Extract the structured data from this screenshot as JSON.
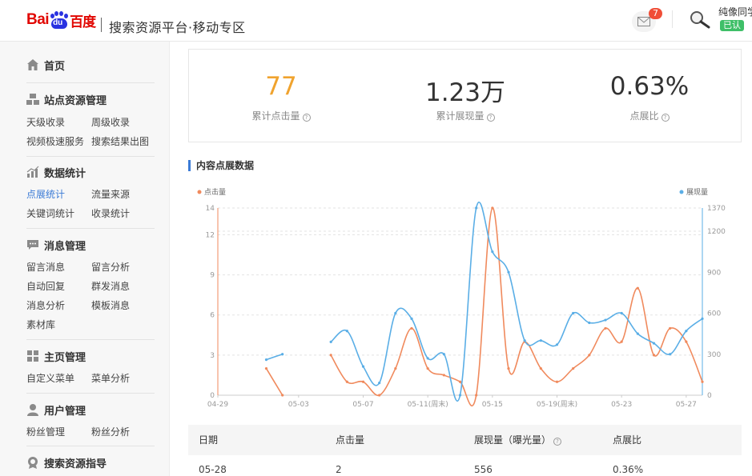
{
  "header": {
    "logo_bai": "Bai",
    "logo_du": "du",
    "logo_cn": "百度",
    "platform_title": "搜索资源平台·移动专区",
    "mail_badge": "7",
    "user_name": "纯像同学",
    "verified": "已认"
  },
  "sidebar": {
    "home": "首页",
    "sections": [
      {
        "title": "站点资源管理",
        "icon": "site-icon",
        "items": [
          "天级收录",
          "周级收录",
          "视频极速服务",
          "搜索结果出图"
        ]
      },
      {
        "title": "数据统计",
        "icon": "chart-icon",
        "items": [
          "点展统计",
          "流量来源",
          "关键词统计",
          "收录统计"
        ]
      },
      {
        "title": "消息管理",
        "icon": "message-icon",
        "items": [
          "留言消息",
          "留言分析",
          "自动回复",
          "群发消息",
          "消息分析",
          "模板消息",
          "素材库"
        ]
      },
      {
        "title": "主页管理",
        "icon": "homepage-icon",
        "items": [
          "自定义菜单",
          "菜单分析"
        ]
      },
      {
        "title": "用户管理",
        "icon": "user-icon",
        "items": [
          "粉丝管理",
          "粉丝分析"
        ]
      },
      {
        "title": "搜索资源指导",
        "icon": "guide-icon",
        "items": []
      }
    ],
    "active_item": "点展统计"
  },
  "stats": [
    {
      "value": "77",
      "label": "累计点击量",
      "color": "#f0a32e"
    },
    {
      "value": "1.23万",
      "label": "累计展现量",
      "color": "#333333"
    },
    {
      "value": "0.63%",
      "label": "点展比",
      "color": "#333333"
    }
  ],
  "section_title": "内容点展数据",
  "chart_data": {
    "type": "line",
    "x_tick_labels": [
      "04-29",
      "05-03",
      "05-07",
      "05-11(周末)",
      "05-15",
      "05-19(周末)",
      "05-23",
      "05-27"
    ],
    "x_range": [
      "04-29",
      "05-28"
    ],
    "left_axis": {
      "ticks": [
        0,
        3,
        6,
        9,
        12,
        14
      ],
      "ylim": [
        0,
        14
      ]
    },
    "right_axis": {
      "ticks": [
        0,
        300,
        600,
        900,
        1200,
        1370
      ],
      "ylim": [
        0,
        1370
      ]
    },
    "legend_left": "点击量",
    "legend_right": "展现量",
    "colors": {
      "clicks": "#f08a5d",
      "impressions": "#5aaee6"
    },
    "series": [
      {
        "name": "点击量",
        "axis": "left",
        "points": [
          [
            "05-01",
            2
          ],
          [
            "05-02",
            0
          ],
          null,
          [
            "05-05",
            3
          ],
          [
            "05-06",
            1
          ],
          [
            "05-07",
            1
          ],
          [
            "05-08",
            0
          ],
          [
            "05-09",
            2
          ],
          [
            "05-10",
            5
          ],
          [
            "05-11",
            2
          ],
          [
            "05-12",
            1.5
          ],
          [
            "05-13",
            1
          ],
          [
            "05-14",
            0
          ],
          [
            "05-15",
            14
          ],
          [
            "05-16",
            2
          ],
          [
            "05-17",
            4
          ],
          [
            "05-18",
            2
          ],
          [
            "05-19",
            1
          ],
          [
            "05-20",
            2
          ],
          [
            "05-21",
            3
          ],
          [
            "05-22",
            5
          ],
          [
            "05-23",
            4
          ],
          [
            "05-24",
            8
          ],
          [
            "05-25",
            3
          ],
          [
            "05-26",
            5
          ],
          [
            "05-27",
            4
          ],
          [
            "05-28",
            1
          ],
          [
            "05-29",
            2
          ]
        ]
      },
      {
        "name": "展现量",
        "axis": "right",
        "points": [
          [
            "05-01",
            260
          ],
          [
            "05-02",
            300
          ],
          null,
          [
            "05-05",
            390
          ],
          [
            "05-06",
            470
          ],
          [
            "05-07",
            210
          ],
          [
            "05-08",
            90
          ],
          [
            "05-09",
            600
          ],
          [
            "05-10",
            560
          ],
          [
            "05-11",
            270
          ],
          [
            "05-12",
            300
          ],
          [
            "05-13",
            0
          ],
          [
            "05-14",
            1370
          ],
          [
            "05-15",
            1050
          ],
          [
            "05-16",
            900
          ],
          [
            "05-17",
            400
          ],
          [
            "05-18",
            400
          ],
          [
            "05-19",
            370
          ],
          [
            "05-20",
            600
          ],
          [
            "05-21",
            530
          ],
          [
            "05-22",
            550
          ],
          [
            "05-23",
            600
          ],
          [
            "05-24",
            450
          ],
          [
            "05-25",
            380
          ],
          [
            "05-26",
            300
          ],
          [
            "05-27",
            470
          ],
          [
            "05-28",
            560
          ]
        ]
      }
    ]
  },
  "table": {
    "headers": [
      "日期",
      "点击量",
      "展现量（曝光量）",
      "点展比"
    ],
    "rows": [
      [
        "05-28",
        "2",
        "556",
        "0.36%"
      ]
    ]
  }
}
